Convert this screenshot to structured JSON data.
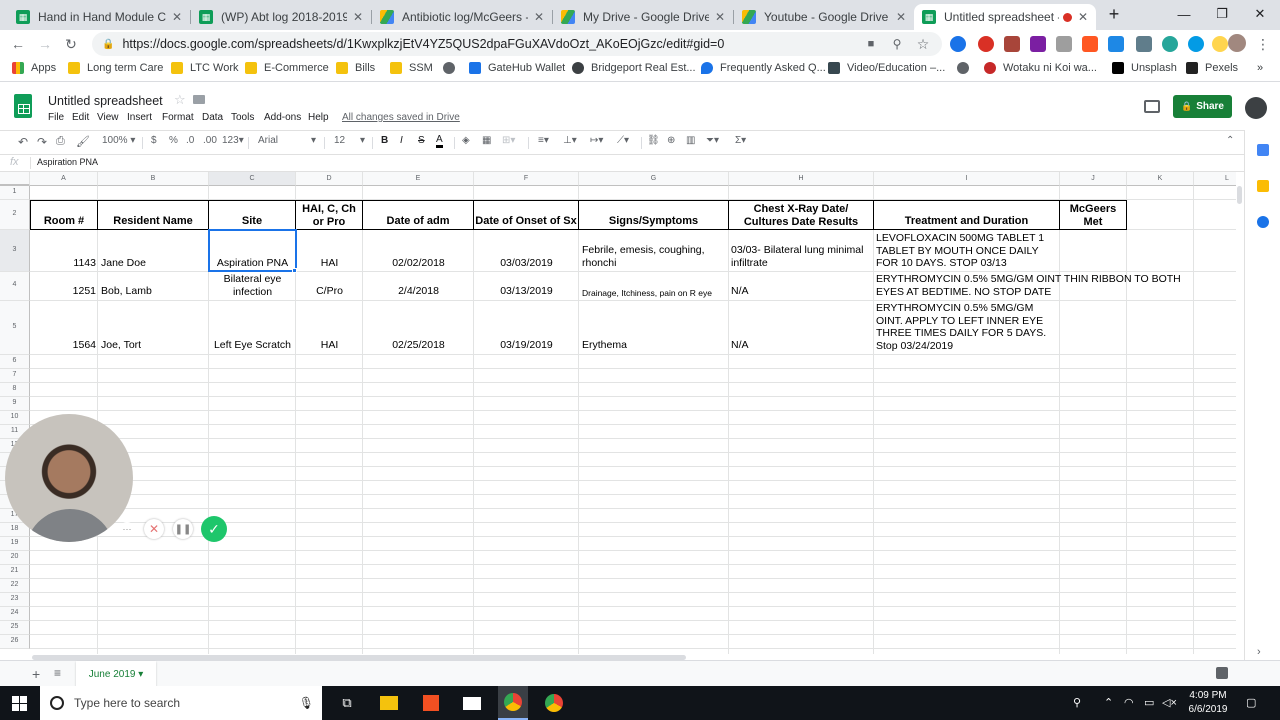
{
  "colors": {
    "accent_blue": "#1a73e8",
    "sheets_green": "#188038",
    "tabstrip_bg": "#dee1e6"
  },
  "browser": {
    "tabs": [
      {
        "title": "Hand in Hand Module Comp",
        "icon": "sheets-favicon"
      },
      {
        "title": "(WP) Abt log 2018-2019 - Go",
        "icon": "sheets-favicon"
      },
      {
        "title": "Antibiotic log/McGeers - Go",
        "icon": "drive-favicon"
      },
      {
        "title": "My Drive - Google Drive",
        "icon": "drive-favicon"
      },
      {
        "title": "Youtube - Google Drive",
        "icon": "drive-favicon"
      },
      {
        "title": "Untitled spreadsheet - G",
        "icon": "sheets-favicon"
      }
    ],
    "url": "https://docs.google.com/spreadsheets/d/1KwxplkzjEtV4YZ5QUS2dpaFGuXAVdoOzt_AKoEOjGzc/edit#gid=0",
    "bookmarks": [
      "Apps",
      "Long term Care",
      "LTC Work",
      "E-Commerce",
      "Bills",
      "SSM",
      "GateHub Wallet",
      "Bridgeport Real Est...",
      "Frequently Asked Q...",
      "Video/Education –...",
      "Wotaku ni Koi wa...",
      "Unsplash",
      "Pexels"
    ]
  },
  "sheets": {
    "doc_title": "Untitled spreadsheet",
    "menu": [
      "File",
      "Edit",
      "View",
      "Insert",
      "Format",
      "Data",
      "Tools",
      "Add-ons",
      "Help"
    ],
    "saved_status": "All changes saved in Drive",
    "share_label": "Share",
    "toolbar": {
      "zoom": "100%",
      "currency": "$",
      "percent": "%",
      "dec_decrease": ".0",
      "dec_increase": ".00",
      "more_formats": "123",
      "font": "Arial",
      "font_size": "12",
      "bold": "B",
      "italic": "I",
      "strike": "S",
      "text_color": "A"
    },
    "formula_bar": {
      "fx": "fx",
      "value": "Aspiration PNA"
    },
    "columns": [
      "A",
      "B",
      "C",
      "D",
      "E",
      "F",
      "G",
      "H",
      "I",
      "J",
      "K",
      "L"
    ],
    "rows": [
      "1",
      "2",
      "3",
      "4",
      "5",
      "6",
      "7",
      "8",
      "9",
      "10",
      "11",
      "12",
      "13",
      "14",
      "15",
      "16",
      "17",
      "18",
      "19",
      "20",
      "21",
      "22",
      "23",
      "24",
      "25",
      "26"
    ],
    "header_row": {
      "room": "Room #",
      "resident": "Resident Name",
      "site": "Site",
      "hai": "HAI, C, Ch or Pro",
      "date_adm": "Date of adm",
      "date_onset": "Date of Onset of Sx",
      "signs": "Signs/Symptoms",
      "xray": "Chest X-Ray Date/ Cultures Date Results",
      "treatment": "Treatment and Duration",
      "mcgeers": "McGeers Met"
    },
    "data_rows": [
      {
        "room": "1143",
        "resident": "Jane Doe",
        "site": "Aspiration PNA",
        "hai": "HAI",
        "date_adm": "02/02/2018",
        "date_onset": "03/03/2019",
        "signs": "Febrile, emesis, coughing, rhonchi",
        "xray": "03/03- Bilateral lung minimal infiltrate",
        "treatment": "LEVOFLOXACIN 500MG TABLET 1 TABLET BY MOUTH ONCE DAILY FOR 10 DAYS. STOP 03/13"
      },
      {
        "room": "1251",
        "resident": "Bob, Lamb",
        "site": "Bilateral eye infection",
        "hai": "C/Pro",
        "date_adm": "2/4/2018",
        "date_onset": "03/13/2019",
        "signs": "Drainage, Itchiness, pain on R eye",
        "xray": "N/A",
        "treatment": "ERYTHROMYCIN 0.5% 5MG/GM OINT THIN RIBBON TO BOTH EYES AT BEDTIME. NO STOP DATE"
      },
      {
        "room": "1564",
        "resident": "Joe, Tort",
        "site": "Left Eye Scratch",
        "hai": "HAI",
        "date_adm": "02/25/2018",
        "date_onset": "03/19/2019",
        "signs": "Erythema",
        "xray": "N/A",
        "treatment": "ERYTHROMYCIN 0.5% 5MG/GM OINT. APPLY TO LEFT INNER EYE THREE TIMES DAILY FOR 5 DAYS. Stop 03/24/2019"
      }
    ],
    "sheet_tab": "June 2019"
  },
  "taskbar": {
    "search_placeholder": "Type here to search",
    "time": "4:09 PM",
    "date": "6/6/2019"
  }
}
